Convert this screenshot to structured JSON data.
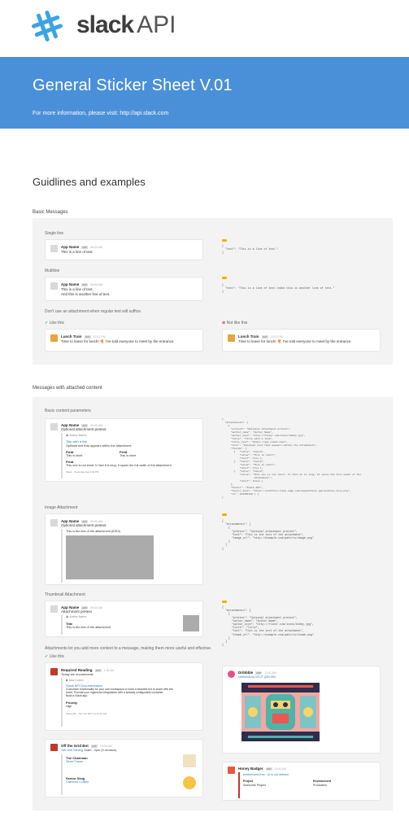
{
  "brand": {
    "name": "slack",
    "suffix": "API"
  },
  "hero": {
    "title": "General Sticker Sheet V.01",
    "subtitle": "For more information, please visit: http://api.slack.com"
  },
  "guidelines_title": "Guidlines and examples",
  "basic": {
    "label": "Basic Messages",
    "single_label": "Single line",
    "multi_label": "Multiline",
    "dont_label": "Don't use an attachment when regular text will suffice.",
    "like_this": "Like this",
    "not_like_this": "Not like this",
    "app_name": "App Name",
    "app_badge": "APP",
    "time": "09:00 AM",
    "single_text": "This is a line of text.",
    "multi_text1": "This is a line of text.",
    "multi_text2": "And this is another line of text.",
    "json_tag": "JSON",
    "single_code": "{\n  \"text\": \"This is a line of text.\"\n}",
    "multi_code": "{\n  \"text\": \"This is a line of text.\\nAnd this is another line of text.\"\n}",
    "lunch_name": "Lunch Train",
    "lunch_time": "12:01 PM",
    "lunch_text": "Time to leave for lunch! 🍕 I've told everyone to meet by the entrance."
  },
  "attached": {
    "label": "Messages with attached content",
    "basic_params": "Basic content parameters",
    "pretext": "Optional attachment pretext",
    "author": "Author Name",
    "title_link": "Title with a link",
    "optional_text": "Optional text that appears within the attachment",
    "field1": "Field",
    "field1_val": "This is short",
    "field2": "Field",
    "field2_val": "This is short",
    "field3": "Field",
    "field3_val": "This one is not short. In fact it is long. It spans the full width of the attachment.",
    "footer": "Slack · Yesterday Sat 9:00 PM",
    "basic_code": "{\n  \"attachments\": [\n    {\n      \"pretext\": \"Optional attachment pretext\",\n      \"author_name\": \"Author Name\",\n      \"author_icon\": \"http://flickr.com/icons/bobby.jpg\",\n      \"title\": \"Title with a link\",\n      \"title_link\": \"https://api.slack.com/\",\n      \"text\": \"Optional text that appears within the attachment\",\n      \"fields\": [\n        {   \"title\": \"Field\",\n            \"value\": \"This is short\",\n            \"short\": true },\n        {   \"title\": \"Field\",\n            \"value\": \"This is short\",\n            \"short\": true },\n        {   \"title\": \"Field\",\n            \"value\": \"This one is not short. In fact it is long. It spans the full width of the\n                      attachment.\",\n            \"short\": false }\n      ],\n      \"footer\": \"Slack API\",\n      \"footer_icon\": \"https://platform.slack-edge.com/img/default_application_icon.png\",\n      \"ts\": 123456789 } ]\n}",
    "image_label": "Image Attachment",
    "image_time": "09:00 AM",
    "image_pretext": "Optional attachment pretext",
    "image_text": "This is the text of the attachment (IDK3)",
    "image_code": "{\n  \"attachments\": [\n    {\n      \"pretext\": \"Optional attachment pretext\",\n      \"text\": \"This is the text of the attachment\",\n      \"image_url\": \"http://example.com/path/to/image.png\"\n    }\n  ]\n}",
    "thumb_label": "Thumbnail Attachment",
    "thumb_pretext": "Attachment pretext",
    "thumb_author": "Author Name",
    "thumb_title": "Title",
    "thumb_text": "This is the text of the attachment",
    "thumb_code": "{\n  \"attachments\": [\n    {\n      \"pretext\": \"Optional attachment pretext\",\n      \"author_name\": \"Author Name\",\n      \"author_icon\": \"http://flickr.com/icons/bobby.jpg\",\n      \"title\": \"Title\",\n      \"text\": \"This is the text of the attachment\",\n      \"thumb_url\": \"http://example.com/path/to/thumb.png\"\n    }\n  ]\n}",
    "context_label": "Attachments let you add more context to a message, making them more useful and effective.",
    "like_this": "Like this"
  },
  "examples": {
    "required_reading": {
      "name": "Required Reading",
      "time": "1:36 AM",
      "intro": "Today we recommend:",
      "author": "Tara Coben",
      "title": "Slack API Documentation",
      "desc1": "Customize functionality for your own workspace or build a beautiful bot to share with the",
      "desc2": "world. Provide your ingenious integrations with a suitably configurable container.",
      "desc3": "Build a Slack app.",
      "priority": "Priority",
      "priority_val": "High",
      "footer": "Slack API · Nov 3rd 2017 at 11:41 AM"
    },
    "dribbble": {
      "name": "Dribbble",
      "time": "11:41 AM",
      "link": "Notebook by NTUT (284 KB)"
    },
    "off_grid": {
      "name": "Off the Grid Bot",
      "time": "10:00 AM",
      "line": "SW and Mining",
      "line2": "11am - 2pm (3 vendors)",
      "vendor1": "The Chairman",
      "vendor1_link": "Street Fusion",
      "vendor2": "Senior Sisig",
      "vendor2_link": "California Cuisine"
    },
    "honey": {
      "name": "Honey Badger",
      "time": "11:41 AM",
      "alert": "#referenced-free · UI is not defined",
      "project": "Project",
      "project_val": "Awesome Project",
      "env": "Environment",
      "env_val": "Production"
    }
  },
  "colors": {
    "hero": "#4a90d9",
    "panel": "#f3f3f3",
    "link": "#2a80b9",
    "json": "#f0b000"
  }
}
